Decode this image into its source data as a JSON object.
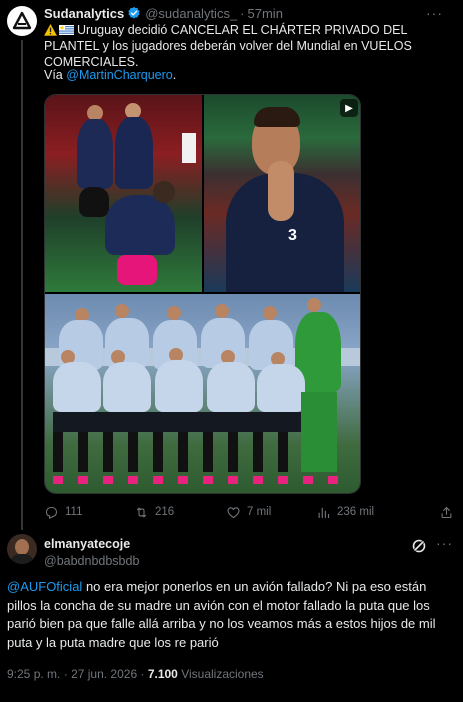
{
  "tweet": {
    "author_name": "Sudanalytics",
    "author_handle": "@sudanalytics_",
    "separator": "·",
    "time_ago": "57min",
    "more": "···",
    "text_line": "Uruguay decidió CANCELAR EL CHÁRTER PRIVADO DEL PLANTEL y los jugadores deberán volver del Mundial en VUELOS COMERCIALES.",
    "via_prefix": "Vía ",
    "via_mention": "@MartinCharquero",
    "via_suffix": ".",
    "counts": {
      "replies": "111",
      "reposts": "216",
      "likes": "7 mil",
      "views": "236 mil"
    }
  },
  "reply": {
    "author_name": "elmanyatecoje",
    "author_handle": "@babdnbdbsbdb",
    "more": "···",
    "mention": "@AUFOficial",
    "text": " no era mejor ponerlos en un avión fallado? Ni pa eso están pillos la concha de su madre un avión con el motor fallado la puta que los parió bien pa que falle allá arriba y no los veamos más a estos hijos de mil puta y la puta madre que los re parió",
    "time": "9:25 p. m.",
    "sep": "·",
    "date": "27 jun. 2026",
    "sep2": "·",
    "views_count": "7.100",
    "views_label": "Visualizaciones"
  },
  "colors": {
    "accent": "#1d9bf0",
    "muted": "#71767b",
    "background": "#000000",
    "text": "#e7e9ea"
  },
  "icons": {
    "avatar": "sudanalytics-logo-icon",
    "verified": "verified-badge-icon",
    "warning": "warning-emoji-icon",
    "flag": "uruguay-flag-icon",
    "reply": "reply-icon",
    "repost": "repost-icon",
    "like": "heart-icon",
    "views": "views-icon",
    "share": "share-icon",
    "grok": "grok-icon",
    "media_badge": "media-badge-icon"
  }
}
